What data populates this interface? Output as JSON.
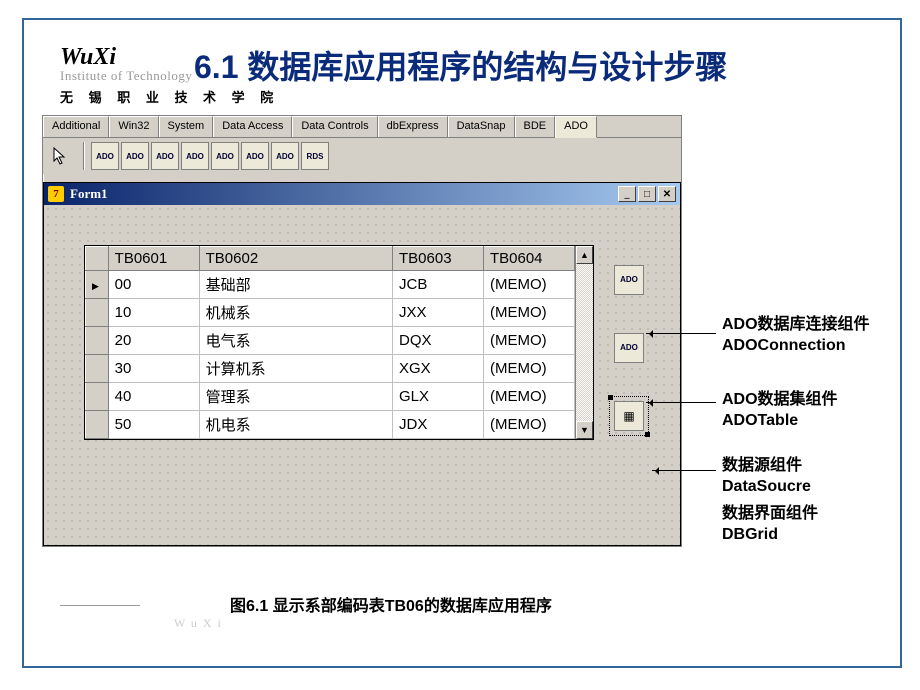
{
  "logo": {
    "main": "WuXi",
    "sub": "Institute of Technology",
    "cn": "无 锡 职 业 技 术 学 院"
  },
  "title": "6.1 数据库应用程序的结构与设计步骤",
  "ide": {
    "tabs": [
      "Additional",
      "Win32",
      "System",
      "Data Access",
      "Data Controls",
      "dbExpress",
      "DataSnap",
      "BDE",
      "ADO"
    ],
    "active_tab": 8,
    "palette_icons": [
      "arrow",
      "ADO",
      "ADO",
      "ADO",
      "ADO",
      "ADO",
      "ADO",
      "ADO",
      "RDS"
    ]
  },
  "form": {
    "title": "Form1",
    "grid": {
      "columns": [
        "TB0601",
        "TB0602",
        "TB0603",
        "TB0604"
      ],
      "rows": [
        [
          "00",
          "基础部",
          "JCB",
          "(MEMO)"
        ],
        [
          "10",
          "机械系",
          "JXX",
          "(MEMO)"
        ],
        [
          "20",
          "电气系",
          "DQX",
          "(MEMO)"
        ],
        [
          "30",
          "计算机系",
          "XGX",
          "(MEMO)"
        ],
        [
          "40",
          "管理系",
          "GLX",
          "(MEMO)"
        ],
        [
          "50",
          "机电系",
          "JDX",
          "(MEMO)"
        ]
      ],
      "current_row": 0
    }
  },
  "callouts": [
    {
      "cn": "ADO数据库连接组件",
      "en": "ADOConnection"
    },
    {
      "cn": "ADO数据集组件",
      "en": "ADOTable"
    },
    {
      "cn": "数据源组件",
      "en": "DataSoucre"
    },
    {
      "cn": "数据界面组件",
      "en": "DBGrid"
    }
  ],
  "caption": "图6.1 显示系部编码表TB06的数据库应用程序",
  "watermark": "WuXi"
}
